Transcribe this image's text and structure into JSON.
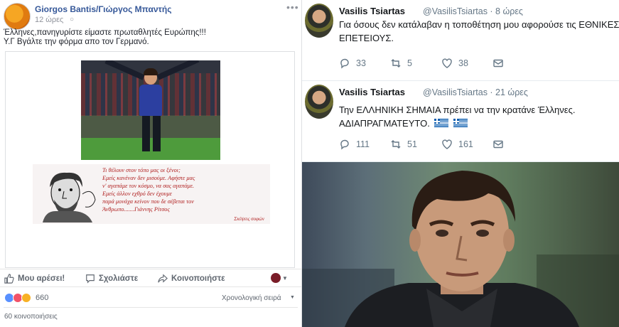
{
  "facebook_post": {
    "author": "Giorgos Bantis/Γιώργος Μπαντής",
    "time": "12 ώρες",
    "privacy_icon": "globe-icon",
    "more_label": "•••",
    "text_line1": "Έλληνες,πανηγυρίστε είμαστε πρωταθλητές Ευρώπης!!!",
    "text_line2": "Υ.Γ Βγάλτε την φόρμα απο τον Γερμανό.",
    "poem": {
      "lines": [
        "Τι θέλουν στον τόπο μας οι ξένοι;",
        "Εμείς κανέναν δεν μισούμε. Αφήστε μας",
        "ν' αγαπάμε τον κόσμο, να σας αγαπάμε.",
        "Εμείς άλλον εχθρό δεν έχουμε",
        "παρά μονάχα κείνον που δε σέβεται τον",
        "Άνθρωπο.......Γιάννης Ρίτσος"
      ],
      "signature": "Σκέψεις σοφών"
    },
    "actions": {
      "like": "Μου αρέσει!",
      "comment": "Σχολιάστε",
      "share": "Κοινοποιήστε"
    },
    "reaction_count": "660",
    "sort_label": "Χρονολογική σειρά",
    "shares": "60 κοινοποιήσεις"
  },
  "tweets": [
    {
      "name": "Vasilis Tsiartas",
      "handle": "@VasilisTsiartas · 8 ώρες",
      "line1": "Για όσους δεν κατάλαβαν η τοποθέτηση μου αφορούσε τις ΕΘΝΙΚΕΣ",
      "line2": "ΕΠΕΤΕΙΟΥΣ.",
      "replies": "33",
      "retweets": "5",
      "likes": "38"
    },
    {
      "name": "Vasilis Tsiartas",
      "handle": "@VasilisTsiartas · 21 ώρες",
      "line1": "Την ΕΛΛΗΝΙΚΗ ΣΗΜΑΙΑ πρέπει να την κρατάνε Έλληνες.",
      "line2": "ΑΔΙΑΠΡΑΓΜΑΤΕΥΤΟ.",
      "replies": "111",
      "retweets": "51",
      "likes": "161"
    }
  ],
  "colors": {
    "facebook_link": "#365899",
    "twitter_grey": "#657786",
    "greek_blue": "#0d5eaf"
  }
}
